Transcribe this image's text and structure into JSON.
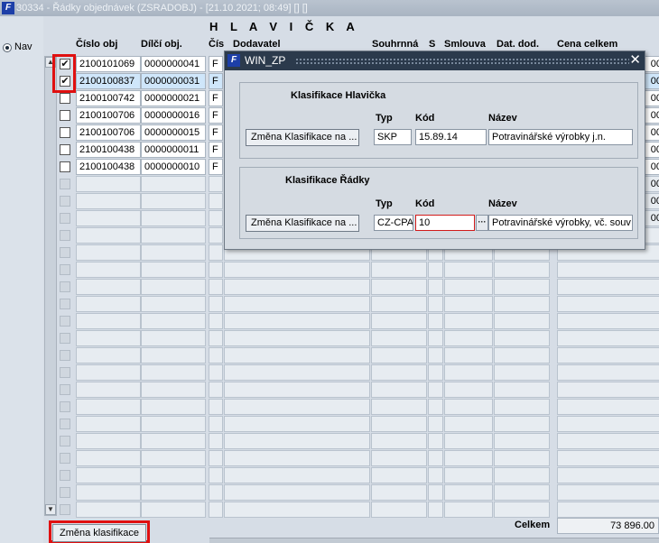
{
  "window": {
    "title": "30334 - Řádky objednávek (ZSRADOBJ) - [21.10.2021; 08:49] [] []",
    "icon": "oracle-forms-icon"
  },
  "left": {
    "nav_label": "Nav"
  },
  "form": {
    "title": "H L A V I Č K A",
    "headers": [
      "Číslo obj",
      "Dílčí obj.",
      "Čís",
      "Dodavatel",
      "Souhrnná",
      "S",
      "Smlouva",
      "Dat. dod.",
      "Cena celkem"
    ],
    "rows": [
      {
        "checked": true,
        "cislo": "2100101069",
        "dilci": "0000000041",
        "cis": "F",
        "selected": false
      },
      {
        "checked": true,
        "cislo": "2100100837",
        "dilci": "0000000031",
        "cis": "F",
        "selected": true
      },
      {
        "checked": false,
        "cislo": "2100100742",
        "dilci": "0000000021",
        "cis": "F",
        "selected": false
      },
      {
        "checked": false,
        "cislo": "2100100706",
        "dilci": "0000000016",
        "cis": "F",
        "selected": false
      },
      {
        "checked": false,
        "cislo": "2100100706",
        "dilci": "0000000015",
        "cis": "F",
        "selected": false
      },
      {
        "checked": false,
        "cislo": "2100100438",
        "dilci": "0000000011",
        "cis": "F",
        "selected": false
      },
      {
        "checked": false,
        "cislo": "2100100438",
        "dilci": "0000000010",
        "cis": "F",
        "selected": false
      }
    ],
    "cena_visible": [
      "00",
      "00",
      "00",
      "00",
      "00",
      "00",
      "00",
      "00",
      "00",
      "00"
    ],
    "bottom_button": "Změna klasifikace",
    "celkem_label": "Celkem",
    "celkem_value": "73 896.00"
  },
  "dialog": {
    "title": "WIN_ZP",
    "close": "✕",
    "header_group": {
      "title": "Klasifikace Hlavička",
      "button": "Změna Klasifikace na ...",
      "typ_label": "Typ",
      "kod_label": "Kód",
      "nazev_label": "Název",
      "typ": "SKP",
      "kod": "15.89.14",
      "nazev": "Potravinářské výrobky j.n."
    },
    "rows_group": {
      "title": "Klasifikace Řádky",
      "button": "Změna Klasifikace na ...",
      "typ_label": "Typ",
      "kod_label": "Kód",
      "nazev_label": "Název",
      "typ": "CZ-CPA",
      "kod": "10",
      "lov": "···",
      "nazev": "Potravinářské výrobky, vč. souv"
    }
  },
  "colors": {
    "highlight": "#e01010",
    "selected_row": "#cfe6fa",
    "dialog_title": "#2b3a4c"
  }
}
